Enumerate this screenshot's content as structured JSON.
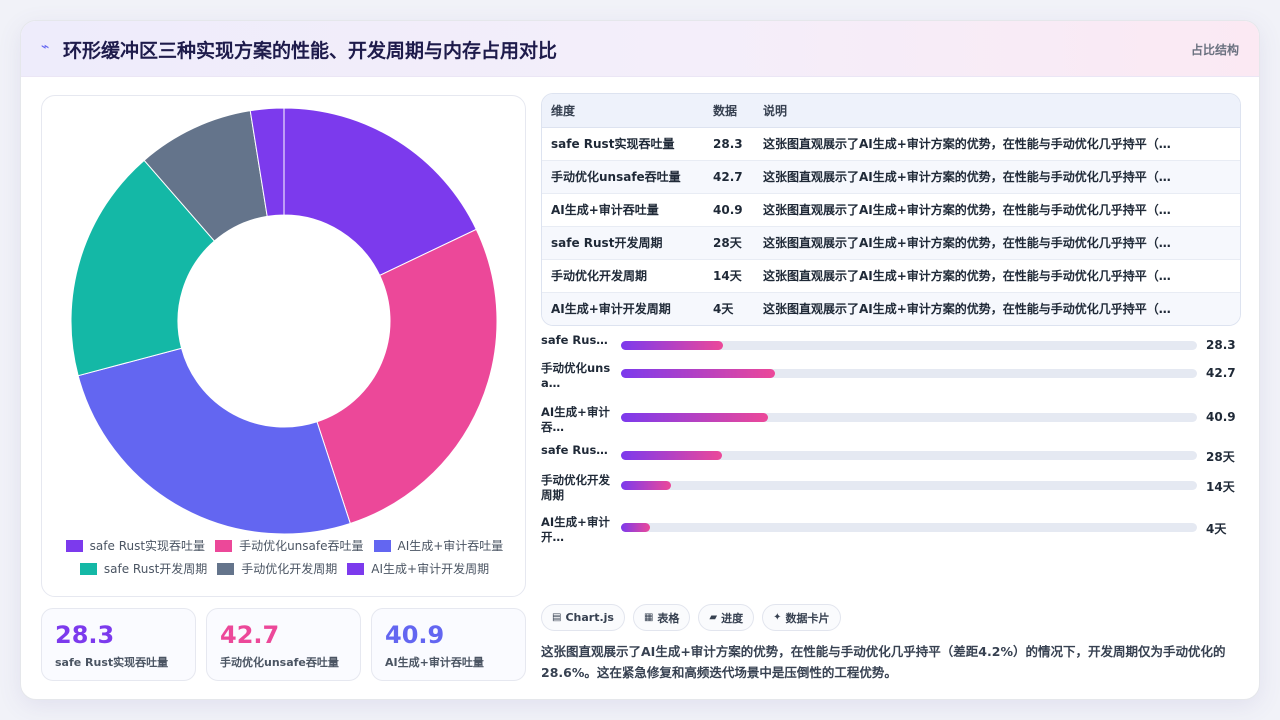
{
  "header": {
    "title": "环形缓冲区三种实现方案的性能、开发周期与内存占用对比",
    "right_label": "占比结构"
  },
  "chart_data": {
    "type": "pie",
    "variant": "doughnut",
    "categories": [
      "safe Rust实现吞吐量",
      "手动优化unsafe吞吐量",
      "AI生成+审计吞吐量",
      "safe Rust开发周期",
      "手动优化开发周期",
      "AI生成+审计开发周期"
    ],
    "values": [
      28.3,
      42.7,
      40.9,
      28,
      14,
      4
    ],
    "display_values": [
      "28.3",
      "42.7",
      "40.9",
      "28天",
      "14天",
      "4天"
    ],
    "colors": [
      "#7c3aed",
      "#ec4899",
      "#6366f1",
      "#14b8a6",
      "#64748b",
      "#7c3aed"
    ],
    "legend_position": "bottom"
  },
  "kpis": [
    {
      "value": "28.3",
      "label": "safe Rust实现吞吐量",
      "color": "#7c3aed"
    },
    {
      "value": "42.7",
      "label": "手动优化unsafe吞吐量",
      "color": "#ec4899"
    },
    {
      "value": "40.9",
      "label": "AI生成+审计吞吐量",
      "color": "#6366f1"
    }
  ],
  "table": {
    "headers": [
      "维度",
      "数据",
      "说明"
    ],
    "rows": [
      {
        "dimension": "safe Rust实现吞吐量",
        "value": "28.3",
        "note": "这张图直观展示了AI生成+审计方案的优势，在性能与手动优化几乎持平（…"
      },
      {
        "dimension": "手动优化unsafe吞吐量",
        "value": "42.7",
        "note": "这张图直观展示了AI生成+审计方案的优势，在性能与手动优化几乎持平（…"
      },
      {
        "dimension": "AI生成+审计吞吐量",
        "value": "40.9",
        "note": "这张图直观展示了AI生成+审计方案的优势，在性能与手动优化几乎持平（…"
      },
      {
        "dimension": "safe Rust开发周期",
        "value": "28天",
        "note": "这张图直观展示了AI生成+审计方案的优势，在性能与手动优化几乎持平（…"
      },
      {
        "dimension": "手动优化开发周期",
        "value": "14天",
        "note": "这张图直观展示了AI生成+审计方案的优势，在性能与手动优化几乎持平（…"
      },
      {
        "dimension": "AI生成+审计开发周期",
        "value": "4天",
        "note": "这张图直观展示了AI生成+审计方案的优势，在性能与手动优化几乎持平（…"
      }
    ]
  },
  "bars": {
    "max": 160,
    "items": [
      {
        "label": "safe Rus…",
        "value": 28.3,
        "display": "28.3"
      },
      {
        "label": "手动优化unsa…",
        "value": 42.7,
        "display": "42.7"
      },
      {
        "label": "AI生成+审计吞…",
        "value": 40.9,
        "display": "40.9"
      },
      {
        "label": "safe Rus…",
        "value": 28,
        "display": "28天"
      },
      {
        "label": "手动优化开发周期",
        "value": 14,
        "display": "14天"
      },
      {
        "label": "AI生成+审计开…",
        "value": 8,
        "display": "4天"
      }
    ]
  },
  "chips": [
    {
      "icon": "▤",
      "label": "Chart.js"
    },
    {
      "icon": "▦",
      "label": "表格"
    },
    {
      "icon": "▰",
      "label": "进度"
    },
    {
      "icon": "✦",
      "label": "数据卡片"
    }
  ],
  "summary": "这张图直观展示了AI生成+审计方案的优势，在性能与手动优化几乎持平（差距4.2%）的情况下，开发周期仅为手动优化的28.6%。这在紧急修复和高频迭代场景中是压倒性的工程优势。"
}
